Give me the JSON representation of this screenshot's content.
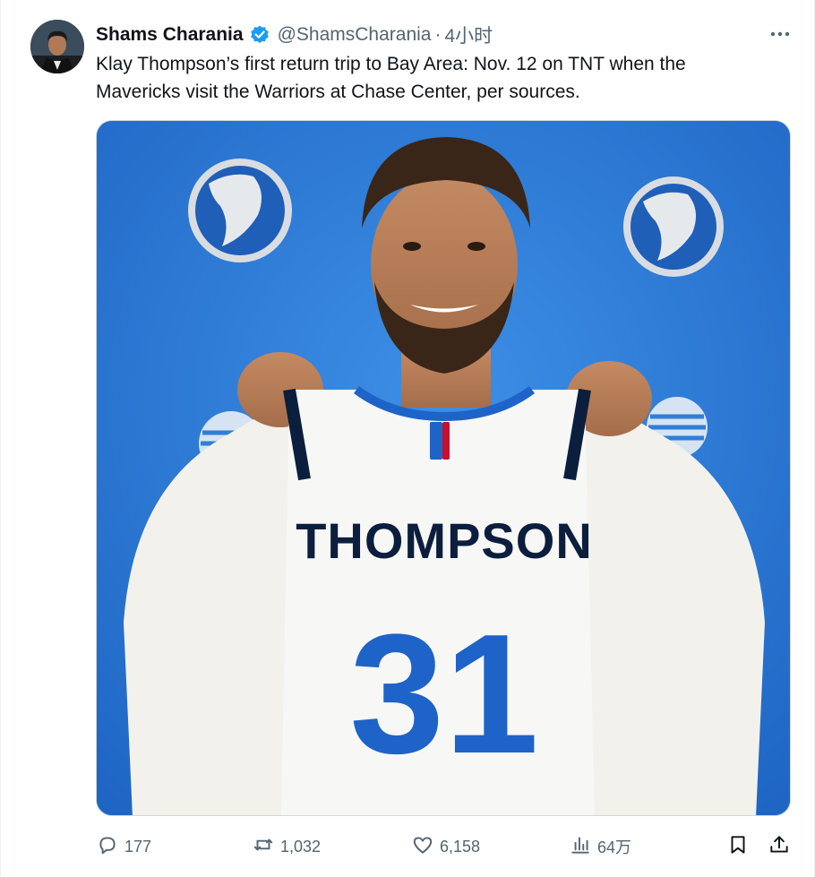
{
  "tweet": {
    "author_name": "Shams Charania",
    "handle": "@ShamsCharania",
    "separator": "·",
    "time": "4小时",
    "text": "Klay Thompson’s first return trip to Bay Area: Nov. 12 on TNT when the\nMavericks visit the Warriors at Chase Center, per sources.",
    "verified": true
  },
  "media": {
    "jersey_name": "THOMPSON",
    "jersey_number": "31"
  },
  "actions": {
    "replies": "177",
    "retweets": "1,032",
    "likes": "6,158",
    "views": "64万"
  },
  "colors": {
    "accent": "#1d9bf0",
    "secondary_text": "#536471",
    "backdrop_blue": "#2f7ed8",
    "jersey_blue": "#1e63c8",
    "jersey_navy": "#0b1e3d"
  },
  "icons": {
    "more": "more-dots-icon",
    "reply": "reply-icon",
    "retweet": "retweet-icon",
    "like": "heart-icon",
    "views": "views-bars-icon",
    "bookmark": "bookmark-icon",
    "share": "share-icon"
  }
}
